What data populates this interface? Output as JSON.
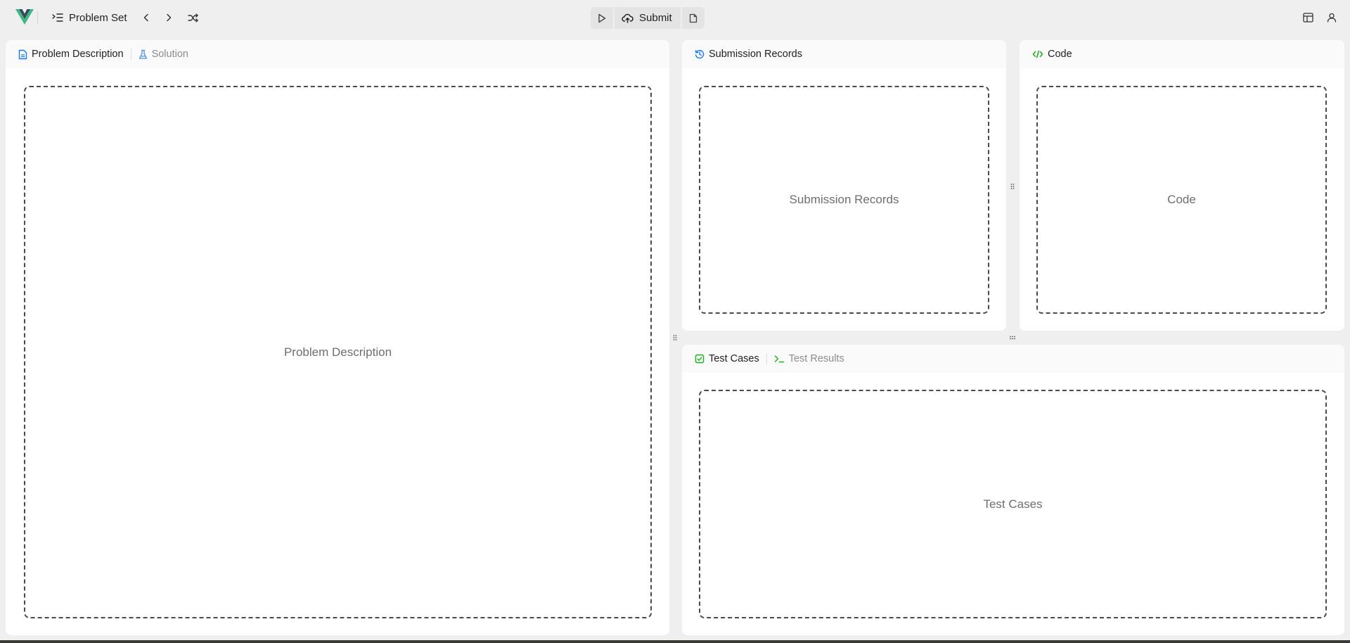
{
  "topbar": {
    "problem_set_label": "Problem Set",
    "submit_label": "Submit"
  },
  "panels": {
    "description": {
      "tabs": [
        {
          "label": "Problem Description",
          "active": true
        },
        {
          "label": "Solution",
          "active": false
        }
      ],
      "placeholder": "Problem Description"
    },
    "submissions": {
      "tabs": [
        {
          "label": "Submission Records",
          "active": true
        }
      ],
      "placeholder": "Submission Records"
    },
    "code": {
      "tabs": [
        {
          "label": "Code",
          "active": true
        }
      ],
      "placeholder": "Code"
    },
    "testcases": {
      "tabs": [
        {
          "label": "Test Cases",
          "active": true
        },
        {
          "label": "Test Results",
          "active": false
        }
      ],
      "placeholder": "Test Cases"
    }
  },
  "colors": {
    "accent_blue": "#1677ff",
    "accent_green": "#1aad19",
    "logo_green": "#41b883",
    "logo_dark": "#35495e",
    "background": "#efefef",
    "panel": "#ffffff"
  }
}
